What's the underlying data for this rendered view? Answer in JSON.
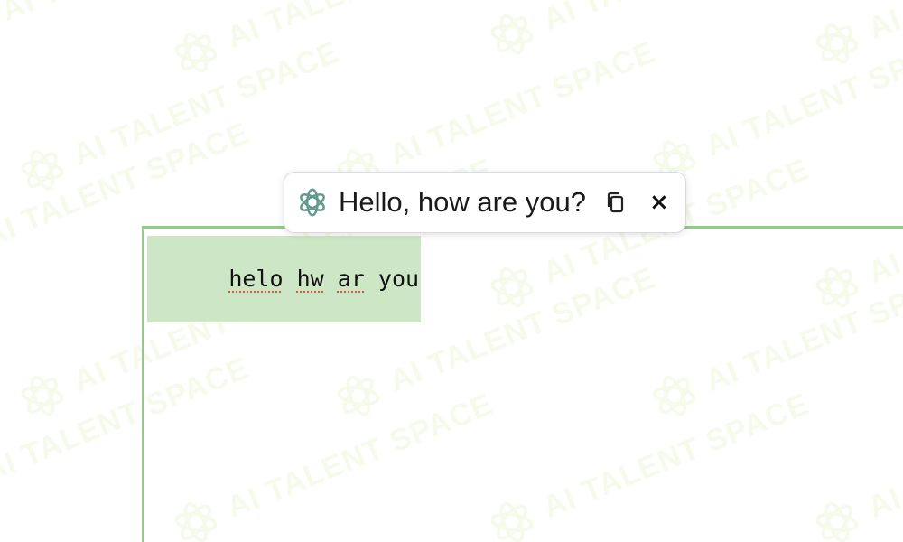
{
  "watermark": {
    "text": "AI TALENT SPACE",
    "color": "#eef7dc"
  },
  "popup": {
    "logo_icon": "openai-logo-icon",
    "suggestion_text": "Hello, how are you?",
    "copy_icon": "copy-icon",
    "close_label": "×"
  },
  "editor": {
    "text_parts": [
      {
        "text": "helo",
        "misspelled": true
      },
      {
        "text": " "
      },
      {
        "text": "hw",
        "misspelled": true
      },
      {
        "text": " "
      },
      {
        "text": "ar",
        "misspelled": true
      },
      {
        "text": " you"
      }
    ],
    "border_color": "#94c98a",
    "selection_color": "#cde7c6",
    "spellcheck_color": "#e0533f"
  }
}
